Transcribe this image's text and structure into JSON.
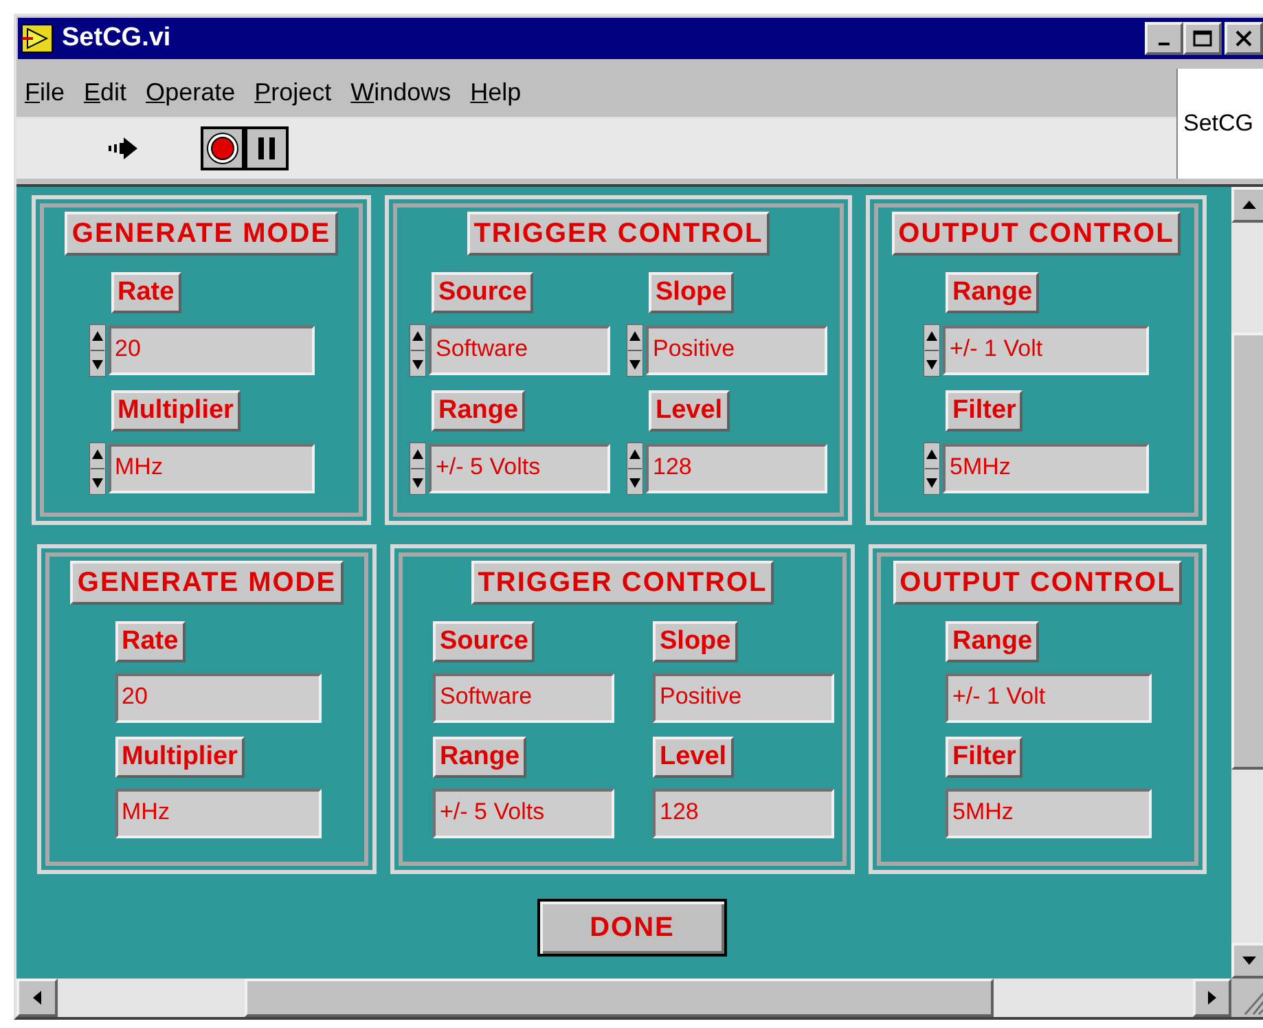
{
  "window": {
    "title": "SetCG.vi"
  },
  "menu": [
    "File",
    "Edit",
    "Operate",
    "Project",
    "Windows",
    "Help"
  ],
  "vi_label": "SetCG",
  "panel_rows": [
    {
      "kind": "control",
      "clusters": [
        {
          "title": "GENERATE MODE",
          "columns": [
            [
              {
                "label": "Rate",
                "value": "20"
              },
              {
                "label": "Multiplier",
                "value": "MHz"
              }
            ]
          ]
        },
        {
          "title": "TRIGGER CONTROL",
          "columns": [
            [
              {
                "label": "Source",
                "value": "Software"
              },
              {
                "label": "Range",
                "value": "+/- 5 Volts"
              }
            ],
            [
              {
                "label": "Slope",
                "value": "Positive"
              },
              {
                "label": "Level",
                "value": "128"
              }
            ]
          ]
        },
        {
          "title": "OUTPUT CONTROL",
          "columns": [
            [
              {
                "label": "Range",
                "value": "+/- 1 Volt"
              },
              {
                "label": "Filter",
                "value": "5MHz"
              }
            ]
          ]
        }
      ]
    },
    {
      "kind": "indicator",
      "clusters": [
        {
          "title": "GENERATE MODE",
          "columns": [
            [
              {
                "label": "Rate",
                "value": "20"
              },
              {
                "label": "Multiplier",
                "value": "MHz"
              }
            ]
          ]
        },
        {
          "title": "TRIGGER CONTROL",
          "columns": [
            [
              {
                "label": "Source",
                "value": "Software"
              },
              {
                "label": "Range",
                "value": "+/- 5 Volts"
              }
            ],
            [
              {
                "label": "Slope",
                "value": "Positive"
              },
              {
                "label": "Level",
                "value": "128"
              }
            ]
          ]
        },
        {
          "title": "OUTPUT CONTROL",
          "columns": [
            [
              {
                "label": "Range",
                "value": "+/- 1 Volt"
              },
              {
                "label": "Filter",
                "value": "5MHz"
              }
            ]
          ]
        }
      ]
    }
  ],
  "done_button": "DONE"
}
